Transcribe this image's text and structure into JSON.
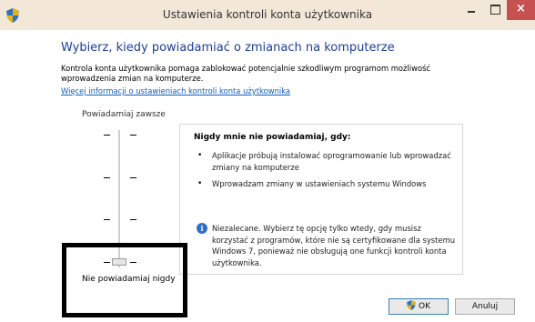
{
  "window": {
    "title": "Ustawienia kontroli konta użytkownika",
    "close_glyph": "×",
    "icon": "uac-shield-icon"
  },
  "main": {
    "heading": "Wybierz, kiedy powiadamiać o zmianach na komputerze",
    "description": "Kontrola konta użytkownika pomaga zablokować potencjalnie szkodliwym programom możliwość wprowadzenia zmian na komputerze.",
    "more_link": "Więcej informacji o ustawieniach kontroli konta użytkownika"
  },
  "slider": {
    "label_top": "Powiadamiaj zawsze",
    "label_bottom": "Nie powiadamiaj nigdy",
    "levels": 4,
    "selected_level": 1
  },
  "info": {
    "title": "Nigdy mnie nie powiadamiaj, gdy:",
    "bullets": [
      "Aplikacje próbują instalować oprogramowanie lub wprowadzać zmiany na komputerze",
      "Wprowadzam zmiany w ustawieniach systemu Windows"
    ],
    "bullet_glyph": "•",
    "note_icon": "i",
    "note": "Niezalecane. Wybierz tę opcję tylko wtedy, gdy musisz korzystać z programów, które nie są certyfikowane dla systemu Windows 7, ponieważ nie obsługują one funkcji kontroli konta użytkownika."
  },
  "buttons": {
    "ok": "OK",
    "cancel": "Anuluj"
  },
  "colors": {
    "titlebar": "#f3e7d8",
    "close": "#c75050",
    "heading": "#1e3f97",
    "link": "#0b5fc4"
  }
}
